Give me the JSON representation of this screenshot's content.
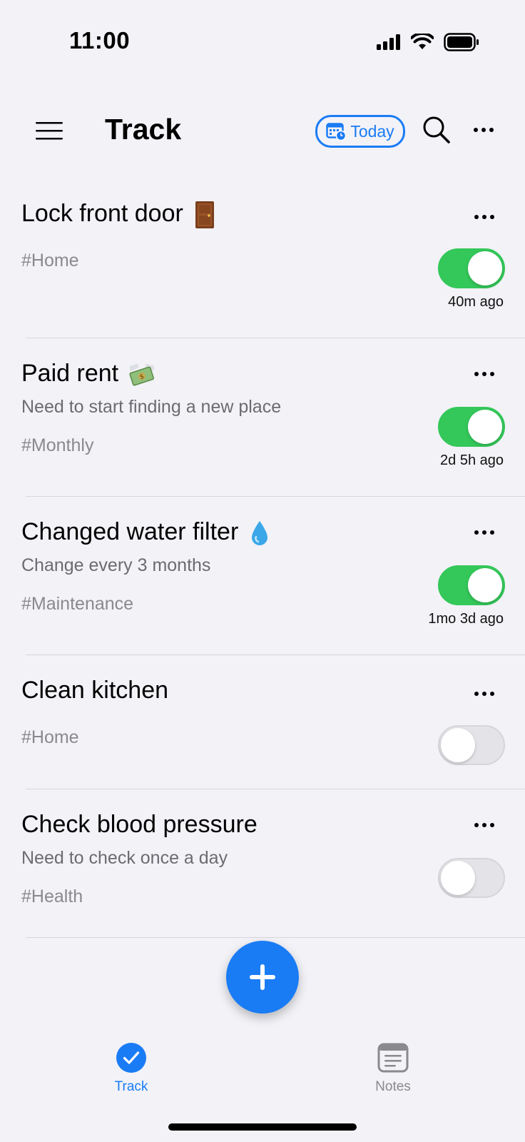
{
  "status_bar": {
    "time": "11:00"
  },
  "header": {
    "title": "Track",
    "today_label": "Today"
  },
  "items": [
    {
      "title": "Lock front door",
      "emoji": "door-emoji",
      "note": "",
      "tag": "#Home",
      "toggle_on": true,
      "time": "40m ago"
    },
    {
      "title": "Paid rent",
      "emoji": "money-wings-emoji",
      "note": "Need to start finding a new place",
      "tag": "#Monthly",
      "toggle_on": true,
      "time": "2d 5h ago"
    },
    {
      "title": "Changed water filter",
      "emoji": "droplet-emoji",
      "note": "Change every 3 months",
      "tag": "#Maintenance",
      "toggle_on": true,
      "time": "1mo 3d ago"
    },
    {
      "title": "Clean kitchen",
      "emoji": "",
      "note": "",
      "tag": "#Home",
      "toggle_on": false,
      "time": ""
    },
    {
      "title": "Check blood pressure",
      "emoji": "",
      "note": "Need to check once a day",
      "tag": "#Health",
      "toggle_on": false,
      "time": ""
    }
  ],
  "tabbar": {
    "track_label": "Track",
    "notes_label": "Notes"
  },
  "colors": {
    "accent": "#1a7cf5",
    "toggle_on": "#34c759",
    "background": "#f2f2f7"
  }
}
